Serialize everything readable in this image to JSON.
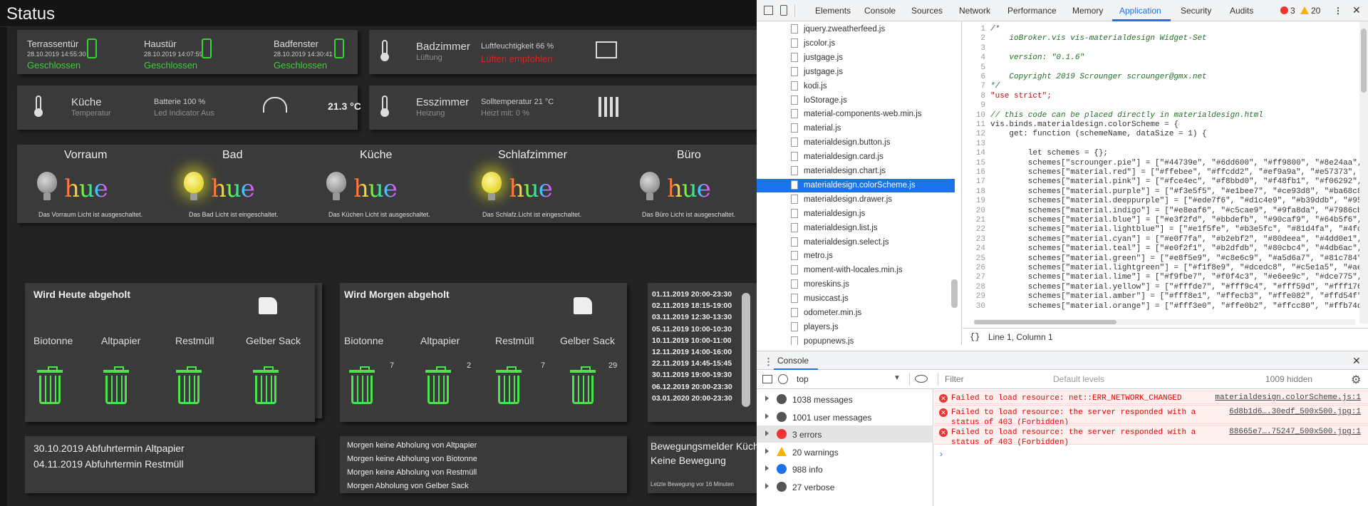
{
  "app": {
    "title": "Status"
  },
  "doors": [
    {
      "name": "Terrassentür",
      "time": "28.10.2019 14:55:30",
      "state": "Geschlossen"
    },
    {
      "name": "Haustür",
      "time": "28.10.2019 14:07:59",
      "state": "Geschlossen"
    },
    {
      "name": "Badfenster",
      "time": "28.10.2019 14:30:41",
      "state": "Geschlossen"
    }
  ],
  "bath": {
    "title": "Badzimmer",
    "subtitle": "Lüftung",
    "humidity": "Luftfeuchtigkeit 66 %",
    "advice": "Lüften empfohlen"
  },
  "kitchen": {
    "title": "Küche",
    "subtitle": "Temperatur",
    "battery": "Batterie 100 %",
    "led": "Led Indicator Aus",
    "temp": "21.3 °C"
  },
  "dining": {
    "title": "Esszimmer",
    "subtitle": "Heizung",
    "setpoint": "Solltemperatur 21 °C",
    "heat": "Heizt mit: 0 %"
  },
  "lights": [
    {
      "room": "Vorraum",
      "status": "Das Vorraum Licht ist ausgeschaltet.",
      "on": false
    },
    {
      "room": "Bad",
      "status": "Das Bad Licht ist eingeschaltet.",
      "on": true
    },
    {
      "room": "Küche",
      "status": "Das Küchen Licht ist ausgeschaltet.",
      "on": false
    },
    {
      "room": "Schlafzimmer",
      "status": "Das Schlafz.Licht ist eingeschaltet.",
      "on": true
    },
    {
      "room": "Büro",
      "status": "Das Büro Licht ist ausgeschaltet.",
      "on": false
    }
  ],
  "hue_word": "hue",
  "pickup_today": {
    "title": "Wird Heute abgeholt",
    "bins": [
      {
        "label": "Biotonne",
        "count": ""
      },
      {
        "label": "Altpapier",
        "count": ""
      },
      {
        "label": "Restmüll",
        "count": ""
      },
      {
        "label": "Gelber Sack",
        "count": ""
      }
    ]
  },
  "pickup_tomorrow": {
    "title": "Wird Morgen abgeholt",
    "bins": [
      {
        "label": "Biotonne",
        "count": "7"
      },
      {
        "label": "Altpapier",
        "count": "2"
      },
      {
        "label": "Restmüll",
        "count": "7"
      },
      {
        "label": "Gelber Sack",
        "count": "29"
      }
    ]
  },
  "schedule": [
    "01.11.2019 20:00-23:30",
    "02.11.2019 18:15-19:00",
    "03.11.2019 12:30-13:30",
    "05.11.2019 10:00-10:30",
    "10.11.2019 10:00-11:00",
    "12.11.2019 14:00-16:00",
    "22.11.2019 14:45-15:45",
    "30.11.2019 19:00-19:30",
    "06.12.2019 20:00-23:30",
    "03.01.2020 20:00-23:30"
  ],
  "next_pickups": [
    "30.10.2019 Abfuhrtermin Altpapier",
    "04.11.2019 Abfuhrtermin Restmüll"
  ],
  "no_pickup": [
    "Morgen keine Abholung von Altpapier",
    "Morgen keine Abholung von Biotonne",
    "Morgen keine Abholung von Restmüll",
    "Morgen Abholung von Gelber Sack"
  ],
  "motion": {
    "title": "Bewegungsmelder Küch",
    "state": "Keine Bewegung",
    "last": "Letzte Bewegung vor 16 Minuten"
  },
  "devtools": {
    "tabs": [
      "Elements",
      "Console",
      "Sources",
      "Network",
      "Performance",
      "Memory",
      "Application",
      "Security",
      "Audits"
    ],
    "active_tab": "Application",
    "error_count": "3",
    "warning_count": "20",
    "files": [
      "jquery.zweatherfeed.js",
      "jscolor.js",
      "justgage.js",
      "justgage.js",
      "kodi.js",
      "loStorage.js",
      "material-components-web.min.js",
      "material.js",
      "materialdesign.button.js",
      "materialdesign.card.js",
      "materialdesign.chart.js",
      "materialdesign.colorScheme.js",
      "materialdesign.drawer.js",
      "materialdesign.js",
      "materialdesign.list.js",
      "materialdesign.select.js",
      "metro.js",
      "moment-with-locales.min.js",
      "moreskins.js",
      "musiccast.js",
      "odometer.min.js",
      "players.js",
      "popupnews.js"
    ],
    "selected_file": "materialdesign.colorScheme.js",
    "code": [
      "/*",
      "    ioBroker.vis vis-materialdesign Widget-Set",
      "",
      "    version: \"0.1.6\"",
      "",
      "    Copyright 2019 Scrounger scrounger@gmx.net",
      "*/",
      "\"use strict\";",
      "",
      "// this code can be placed directly in materialdesign.html",
      "vis.binds.materialdesign.colorScheme = {",
      "    get: function (schemeName, dataSize = 1) {",
      "",
      "        let schemes = {};",
      "        schemes[\"scrounger.pie\"] = [\"#44739e\", \"#6dd600\", \"#ff9800\", \"#8e24aa\",",
      "        schemes[\"material.red\"] = [\"#ffebee\", \"#ffcdd2\", \"#ef9a9a\", \"#e57373\",",
      "        schemes[\"material.pink\"] = [\"#fce4ec\", \"#f8bbd0\", \"#f48fb1\", \"#f06292\",",
      "        schemes[\"material.purple\"] = [\"#f3e5f5\", \"#e1bee7\", \"#ce93d8\", \"#ba68c8\",",
      "        schemes[\"material.deeppurple\"] = [\"#ede7f6\", \"#d1c4e9\", \"#b39ddb\", \"#9575cd\",",
      "        schemes[\"material.indigo\"] = [\"#e8eaf6\", \"#c5cae9\", \"#9fa8da\", \"#7986cb\",",
      "        schemes[\"material.blue\"] = [\"#e3f2fd\", \"#bbdefb\", \"#90caf9\", \"#64b5f6\",",
      "        schemes[\"material.lightblue\"] = [\"#e1f5fe\", \"#b3e5fc\", \"#81d4fa\", \"#4fc3f7\",",
      "        schemes[\"material.cyan\"] = [\"#e0f7fa\", \"#b2ebf2\", \"#80deea\", \"#4dd0e1\",",
      "        schemes[\"material.teal\"] = [\"#e0f2f1\", \"#b2dfdb\", \"#80cbc4\", \"#4db6ac\",",
      "        schemes[\"material.green\"] = [\"#e8f5e9\", \"#c8e6c9\", \"#a5d6a7\", \"#81c784\",",
      "        schemes[\"material.lightgreen\"] = [\"#f1f8e9\", \"#dcedc8\", \"#c5e1a5\", \"#aed581\",",
      "        schemes[\"material.lime\"] = [\"#f9fbe7\", \"#f0f4c3\", \"#e6ee9c\", \"#dce775\",",
      "        schemes[\"material.yellow\"] = [\"#fffde7\", \"#fff9c4\", \"#fff59d\", \"#fff176\",",
      "        schemes[\"material.amber\"] = [\"#fff8e1\", \"#ffecb3\", \"#ffe082\", \"#ffd54f\",",
      "        schemes[\"material.orange\"] = [\"#fff3e0\", \"#ffe0b2\", \"#ffcc80\", \"#ffb74d\","
    ],
    "status": "Line 1, Column 1",
    "drawer_tab": "Console",
    "context": "top",
    "filter_placeholder": "Filter",
    "levels": "Default levels",
    "hidden": "1009 hidden",
    "sidebar": [
      {
        "label": "1038 messages",
        "icon": "list-icon"
      },
      {
        "label": "1001 user messages",
        "icon": "user-icon"
      },
      {
        "label": "3 errors",
        "icon": "error-icon"
      },
      {
        "label": "20 warnings",
        "icon": "warning-icon"
      },
      {
        "label": "988 info",
        "icon": "info-icon"
      },
      {
        "label": "27 verbose",
        "icon": "bug-icon"
      }
    ],
    "errors": [
      {
        "msg": "Failed to load resource: net::ERR_NETWORK_CHANGED",
        "src": "materialdesign.colorScheme.js:1"
      },
      {
        "msg": "Failed to load resource: the server responded with a status of 403 (Forbidden)",
        "src": "6d8b1d6….30edf_500x500.jpg:1"
      },
      {
        "msg": "Failed to load resource: the server responded with a status of 403 (Forbidden)",
        "src": "88665e7….75247_500x500.jpg:1"
      }
    ],
    "colors": {
      "accent": "#1a73e8",
      "error": "#e00000",
      "selection": "#1a73e8"
    }
  },
  "colors": {
    "ok": "#35d335",
    "alert": "#e02020",
    "card": "#3a3a3a"
  }
}
